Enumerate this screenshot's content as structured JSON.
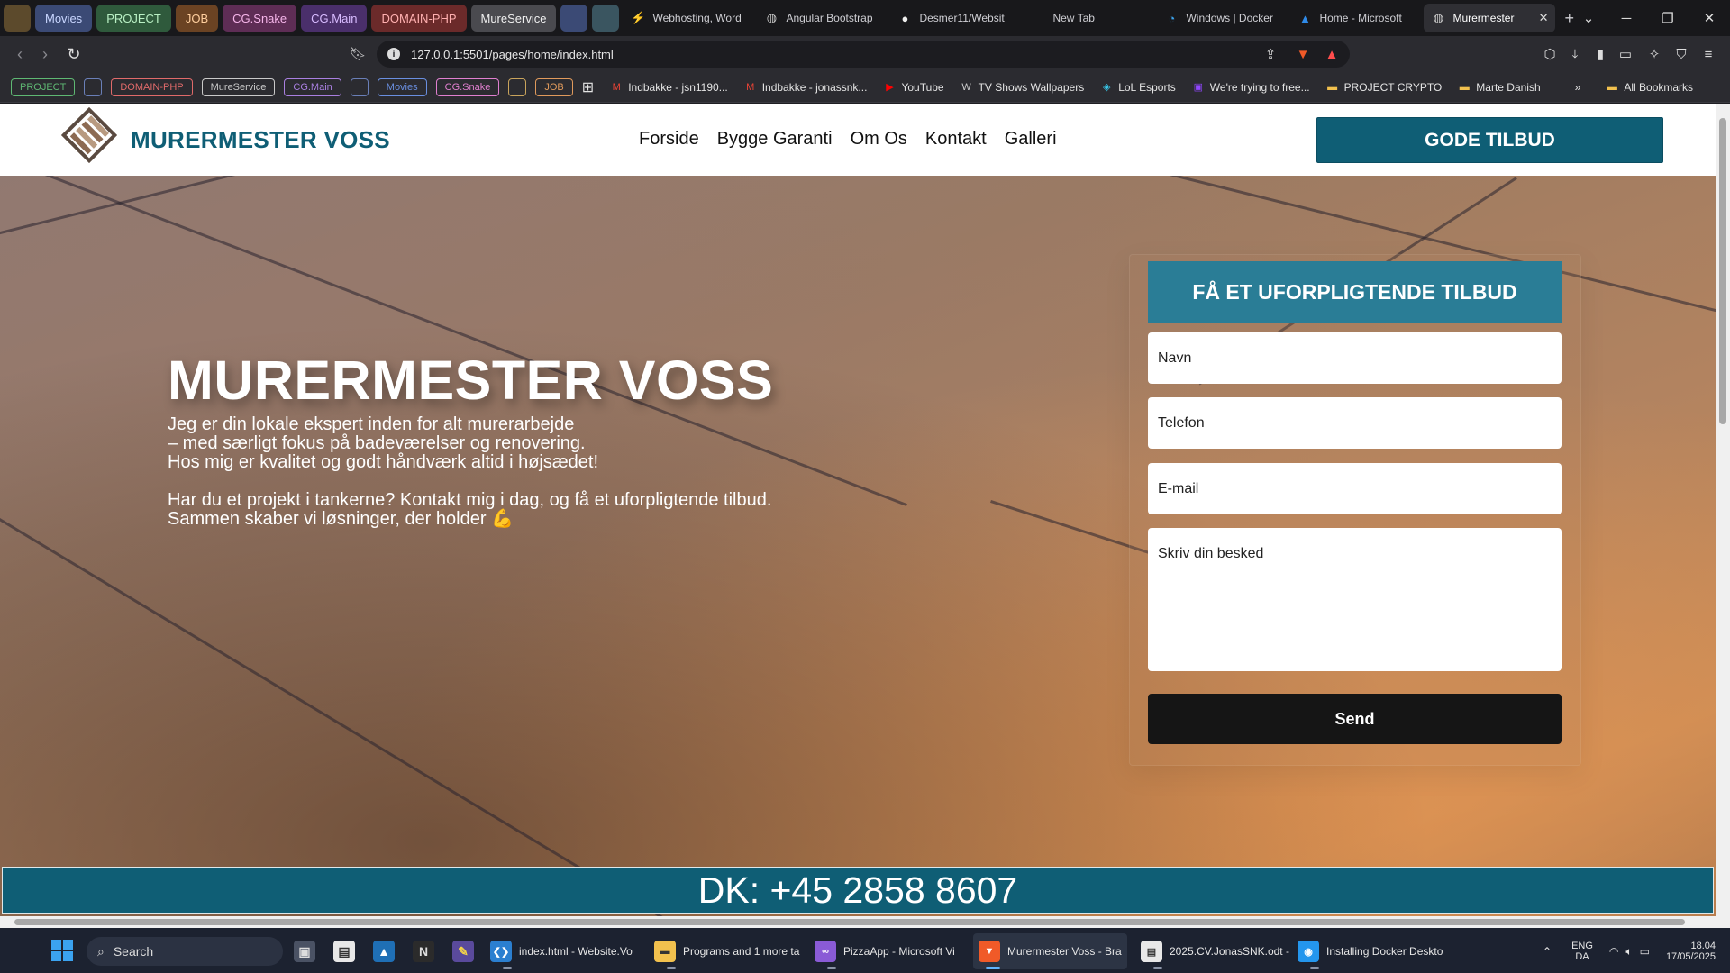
{
  "browser": {
    "tab_groups": [
      {
        "label": "",
        "color": "#5c4a2c"
      },
      {
        "label": "Movies",
        "color": "#3b4a75",
        "text_color": "#c9d6ff"
      },
      {
        "label": "PROJECT",
        "color": "#2f5a3c",
        "text_color": "#b9f0c4"
      },
      {
        "label": "JOB",
        "color": "#6b4323",
        "text_color": "#ffcf9e"
      },
      {
        "label": "CG.Snake",
        "color": "#5e2d55",
        "text_color": "#f6b5ea"
      },
      {
        "label": "CG.Main",
        "color": "#4a2f6b",
        "text_color": "#d8bbff"
      },
      {
        "label": "DOMAIN-PHP",
        "color": "#6b2a2a",
        "text_color": "#ffb0b0"
      },
      {
        "label": "MureService",
        "color": "#4a4a4f",
        "text_color": "#f0f0f0"
      },
      {
        "label": "",
        "color": "#3b4a75"
      },
      {
        "label": "",
        "color": "#3a5560"
      }
    ],
    "tabs": [
      {
        "title": "Webhosting, Word",
        "icon": "bolt-icon"
      },
      {
        "title": "Angular Bootstrap",
        "icon": "globe-icon"
      },
      {
        "title": "Desmer11/Websit",
        "icon": "github-icon"
      },
      {
        "title": "New Tab",
        "icon": ""
      },
      {
        "title": "Windows | Docker",
        "icon": "edge-icon"
      },
      {
        "title": "Home - Microsoft",
        "icon": "azure-icon"
      },
      {
        "title": "Murermester",
        "icon": "globe-icon",
        "active": true
      }
    ],
    "url": "127.0.0.1:5501/pages/home/index.html",
    "bookmark_groups": [
      {
        "label": "PROJECT",
        "color": "#5fb873"
      },
      {
        "label": "",
        "color": "#6a7fb8"
      },
      {
        "label": "DOMAIN-PHP",
        "color": "#e06a6a"
      },
      {
        "label": "MureService",
        "color": "#c9c9c9"
      },
      {
        "label": "CG.Main",
        "color": "#a97fe0"
      },
      {
        "label": "",
        "color": "#6a7fb8"
      },
      {
        "label": "Movies",
        "color": "#6a8fe0"
      },
      {
        "label": "CG.Snake",
        "color": "#e07fcf"
      },
      {
        "label": "",
        "color": "#c9a45c"
      },
      {
        "label": "JOB",
        "color": "#e09a5c"
      }
    ],
    "bookmarks": [
      {
        "label": "Indbakke - jsn1190...",
        "icon": "gmail-icon"
      },
      {
        "label": "Indbakke - jonassnk...",
        "icon": "gmail-icon"
      },
      {
        "label": "YouTube",
        "icon": "youtube-icon"
      },
      {
        "label": "TV Shows Wallpapers",
        "icon": "wallpaper-icon"
      },
      {
        "label": "LoL Esports",
        "icon": "lol-icon"
      },
      {
        "label": "We're trying to free...",
        "icon": "twitch-icon"
      },
      {
        "label": "PROJECT CRYPTO",
        "icon": "folder-icon"
      },
      {
        "label": "Marte Danish",
        "icon": "folder-icon"
      }
    ],
    "all_bookmarks": "All Bookmarks"
  },
  "site": {
    "logo_text": "MURERMESTER VOSS",
    "nav": [
      "Forside",
      "Bygge Garanti",
      "Om Os",
      "Kontakt",
      "Galleri"
    ],
    "cta": "GODE TILBUD",
    "hero": {
      "title": "MURERMESTER VOSS",
      "lines": [
        "Jeg er din lokale ekspert inden for alt murerarbejde",
        "– med særligt fokus på badeværelser og renovering.",
        "Hos mig er kvalitet og godt håndværk altid i højsædet!",
        "Har du et projekt i tankerne? Kontakt mig i dag, og få et uforpligtende tilbud.",
        "Sammen skaber vi løsninger, der holder 💪"
      ]
    },
    "form": {
      "title": "FÅ ET UFORPLIGTENDE TILBUD",
      "name_placeholder": "Navn",
      "phone_placeholder": "Telefon",
      "email_placeholder": "E-mail",
      "message_placeholder": "Skriv din besked",
      "submit": "Send"
    },
    "phone_bar": "DK: +45 2858 8607",
    "brand_color": "#0f5e75"
  },
  "taskbar": {
    "search": "Search",
    "apps": [
      {
        "label": "index.html - Website.Vo",
        "icon": "vscode-icon"
      },
      {
        "label": "Programs and 1 more ta",
        "icon": "folder-icon"
      },
      {
        "label": "PizzaApp - Microsoft Vi",
        "icon": "visual-studio-icon"
      },
      {
        "label": "Murermester Voss - Bra",
        "icon": "brave-icon",
        "active": true
      },
      {
        "label": "2025.CV.JonasSNK.odt -",
        "icon": "document-icon"
      },
      {
        "label": "Installing Docker Deskto",
        "icon": "docker-icon"
      }
    ],
    "lang": "ENG",
    "region": "DA",
    "time": "18.04",
    "date": "17/05/2025"
  }
}
